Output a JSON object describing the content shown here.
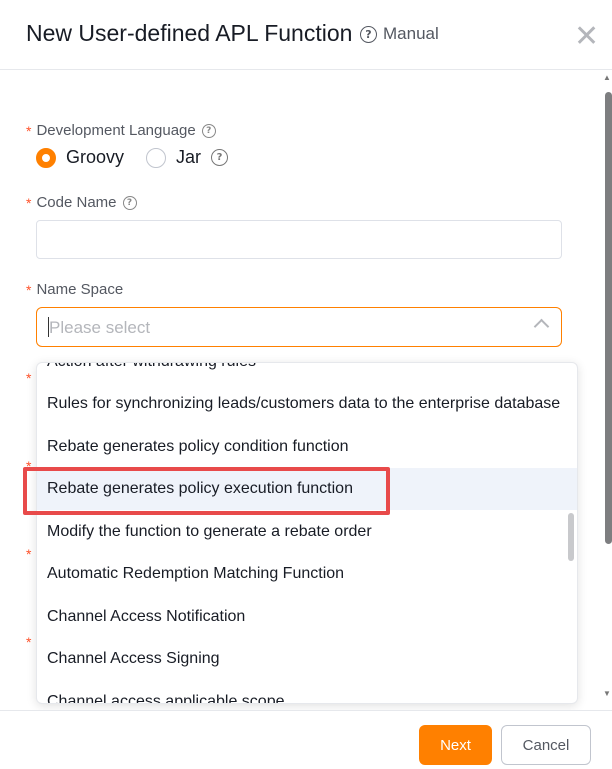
{
  "dialog": {
    "title": "New User-defined APL Function",
    "manual_label": "Manual",
    "close_icon": "close-icon"
  },
  "form": {
    "dev_language": {
      "label": "Development Language",
      "options": [
        "Groovy",
        "Jar"
      ],
      "selected": "Groovy"
    },
    "code_name": {
      "label": "Code Name",
      "value": ""
    },
    "name_space": {
      "label": "Name Space",
      "placeholder": "Please select",
      "options": [
        "Action after withdrawing rules",
        "Rules for synchronizing leads/customers data to the enterprise database",
        "Rebate generates policy condition function",
        "Rebate generates policy execution function",
        "Modify the function to generate a rebate order",
        "Automatic Redemption Matching Function",
        "Channel Access Notification",
        "Channel Access Signing",
        "Channel access applicable scope"
      ],
      "hovered_index": 3
    }
  },
  "footer": {
    "next_label": "Next",
    "cancel_label": "Cancel"
  },
  "colors": {
    "accent": "#ff8000",
    "required": "#ff522a",
    "highlight_box": "#e84a4a",
    "hover_bg": "#eff3fa"
  }
}
